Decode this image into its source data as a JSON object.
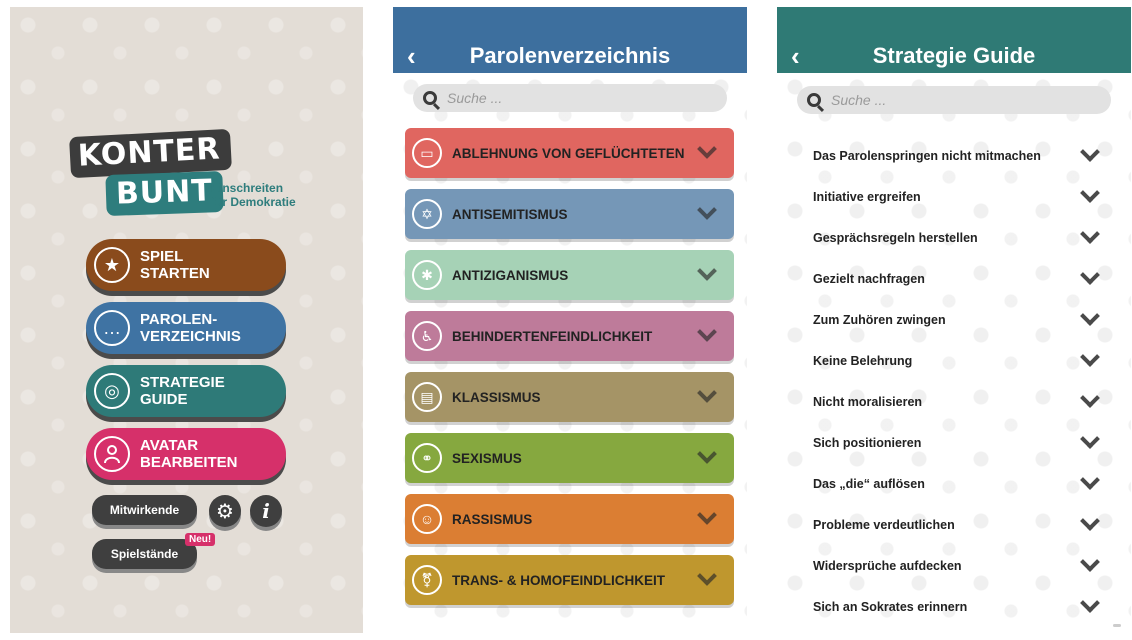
{
  "main_menu": {
    "logo": {
      "word1": "KONTER",
      "word2": "BUNT",
      "tagline": "Einschreiten\nfür Demokratie"
    },
    "buttons": [
      {
        "label": "SPIEL\nSTARTEN",
        "icon": "star-icon",
        "color": "#8a4b1c"
      },
      {
        "label": "PAROLEN-\nVERZEICHNIS",
        "icon": "speech-bubble-icon",
        "color": "#3f73a3"
      },
      {
        "label": "STRATEGIE\nGUIDE",
        "icon": "target-icon",
        "color": "#2e7a78"
      },
      {
        "label": "AVATAR\nBEARBEITEN",
        "icon": "person-icon",
        "color": "#d6306a"
      }
    ],
    "contributors_label": "Mitwirkende",
    "savegames_label": "Spielstände",
    "new_badge": "Neu!",
    "settings_icon": "gear-icon",
    "info_icon": "info-icon"
  },
  "parolen": {
    "title": "Parolenverzeichnis",
    "header_color": "#3d6f9e",
    "search_placeholder": "Suche ...",
    "categories": [
      {
        "label": "ABLEHNUNG VON GEFLÜCHTETEN",
        "icon": "id-card-icon",
        "color": "#e06660"
      },
      {
        "label": "ANTISEMITISMUS",
        "icon": "star-of-david-icon",
        "color": "#7597b7"
      },
      {
        "label": "ANTIZIGANISMUS",
        "icon": "wheel-icon",
        "color": "#a6d2b6"
      },
      {
        "label": "BEHINDERTENFEINDLICHKEIT",
        "icon": "wheelchair-icon",
        "color": "#be7b9a"
      },
      {
        "label": "KLASSISMUS",
        "icon": "money-icon",
        "color": "#a59466"
      },
      {
        "label": "SEXISMUS",
        "icon": "gender-icon",
        "color": "#86a83f"
      },
      {
        "label": "RASSISMUS",
        "icon": "people-icon",
        "color": "#db7e33"
      },
      {
        "label": "TRANS- & HOMOFEINDLICHKEIT",
        "icon": "transgender-icon",
        "color": "#bf972e"
      }
    ]
  },
  "strategie": {
    "title": "Strategie Guide",
    "header_color": "#2f7a75",
    "search_placeholder": "Suche ...",
    "items": [
      "Das Parolenspringen nicht mitmachen",
      "Initiative ergreifen",
      "Gesprächsregeln herstellen",
      "Gezielt nachfragen",
      "Zum Zuhören zwingen",
      "Keine Belehrung",
      "Nicht moralisieren",
      "Sich positionieren",
      "Das „die“ auflösen",
      "Probleme verdeutlichen",
      "Widersprüche aufdecken",
      "Sich an Sokrates erinnern"
    ]
  }
}
